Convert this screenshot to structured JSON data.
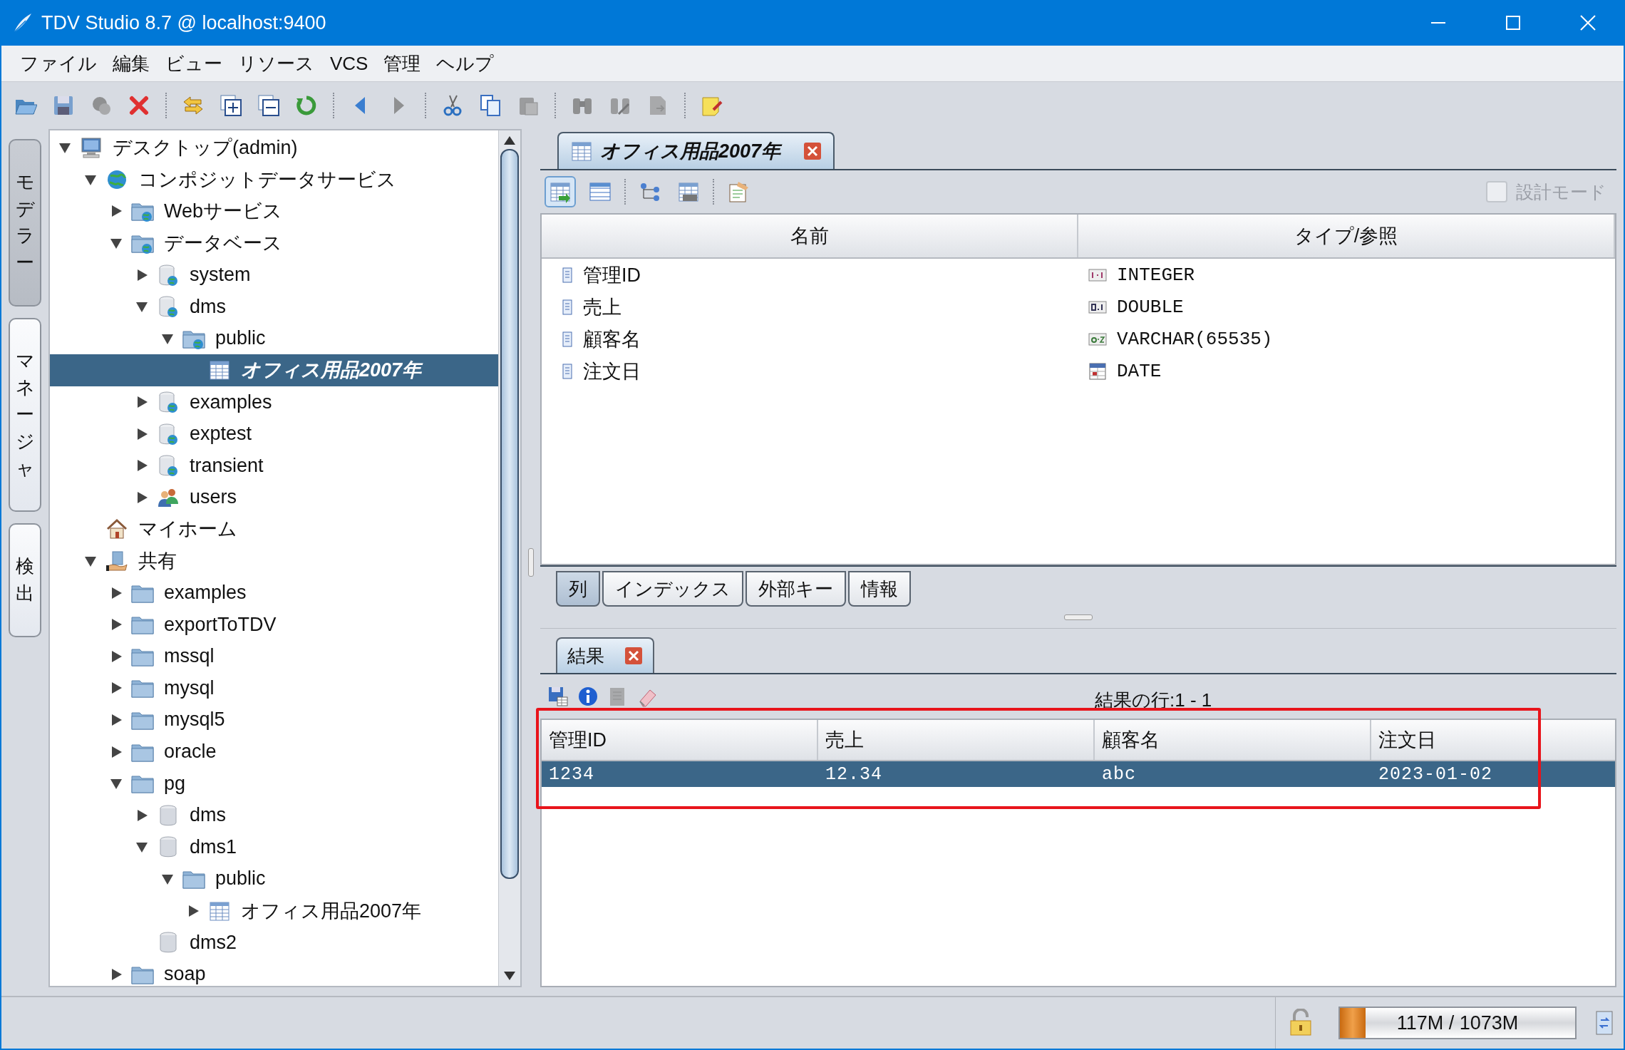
{
  "window": {
    "title": "TDV Studio 8.7 @ localhost:9400"
  },
  "menu": [
    {
      "label": "ファイル"
    },
    {
      "label": "編集"
    },
    {
      "label": "ビュー"
    },
    {
      "label": "リソース"
    },
    {
      "label": "VCS"
    },
    {
      "label": "管理"
    },
    {
      "label": "ヘルプ"
    }
  ],
  "toolbar": [
    [
      {
        "disabled": false
      },
      {
        "disabled": true
      },
      {
        "disabled": true
      },
      {
        "disabled": false
      }
    ],
    [
      {
        "disabled": false
      },
      {
        "disabled": false
      },
      {
        "disabled": false
      },
      {
        "disabled": false
      }
    ],
    [
      {
        "disabled": false
      },
      {
        "disabled": true
      }
    ],
    [
      {
        "disabled": false
      },
      {
        "disabled": false
      },
      {
        "disabled": true
      }
    ],
    [
      {
        "disabled": true
      },
      {
        "disabled": true
      },
      {
        "disabled": true
      }
    ],
    [
      {
        "disabled": false
      }
    ]
  ],
  "side_tabs": [
    {
      "label": "モデラー",
      "selected": true
    },
    {
      "label": "マネージャ",
      "selected": false
    },
    {
      "label": "検出",
      "selected": false
    }
  ],
  "tree": {
    "items": [
      {
        "label": "デスクトップ(admin)",
        "kind": "computer",
        "expanded": true,
        "selected": false,
        "children": [
          {
            "label": "コンポジットデータサービス",
            "kind": "globe",
            "expanded": true,
            "selected": false,
            "children": [
              {
                "label": "Webサービス",
                "kind": "webfolder",
                "expanded": false,
                "selected": false
              },
              {
                "label": "データベース",
                "kind": "webfolder",
                "expanded": true,
                "selected": false,
                "children": [
                  {
                    "label": "system",
                    "kind": "webdb",
                    "expanded": false,
                    "selected": false
                  },
                  {
                    "label": "dms",
                    "kind": "webdb",
                    "expanded": true,
                    "selected": false,
                    "children": [
                      {
                        "label": "public",
                        "kind": "webfolder",
                        "expanded": true,
                        "selected": false,
                        "children": [
                          {
                            "label": "オフィス用品2007年",
                            "kind": "table",
                            "selected": true
                          }
                        ]
                      }
                    ]
                  },
                  {
                    "label": "examples",
                    "kind": "webdb",
                    "expanded": false,
                    "selected": false
                  },
                  {
                    "label": "exptest",
                    "kind": "webdb",
                    "expanded": false,
                    "selected": false
                  },
                  {
                    "label": "transient",
                    "kind": "webdb",
                    "expanded": false,
                    "selected": false
                  },
                  {
                    "label": "users",
                    "kind": "users",
                    "expanded": false,
                    "selected": false
                  }
                ]
              }
            ]
          },
          {
            "label": "マイホーム",
            "kind": "home",
            "selected": false
          },
          {
            "label": "共有",
            "kind": "shared",
            "expanded": true,
            "selected": false,
            "children": [
              {
                "label": "examples",
                "kind": "folder",
                "expanded": false,
                "selected": false
              },
              {
                "label": "exportToTDV",
                "kind": "folder",
                "expanded": false,
                "selected": false
              },
              {
                "label": "mssql",
                "kind": "folder",
                "expanded": false,
                "selected": false
              },
              {
                "label": "mysql",
                "kind": "folder",
                "expanded": false,
                "selected": false
              },
              {
                "label": "mysql5",
                "kind": "folder",
                "expanded": false,
                "selected": false
              },
              {
                "label": "oracle",
                "kind": "folder",
                "expanded": false,
                "selected": false
              },
              {
                "label": "pg",
                "kind": "folder",
                "expanded": true,
                "selected": false,
                "children": [
                  {
                    "label": "dms",
                    "kind": "db",
                    "expanded": false,
                    "selected": false
                  },
                  {
                    "label": "dms1",
                    "kind": "db",
                    "expanded": true,
                    "selected": false,
                    "children": [
                      {
                        "label": "public",
                        "kind": "folder",
                        "expanded": true,
                        "selected": false,
                        "children": [
                          {
                            "label": "オフィス用品2007年",
                            "kind": "table",
                            "expanded": false,
                            "selected": false
                          }
                        ]
                      }
                    ]
                  },
                  {
                    "label": "dms2",
                    "kind": "db",
                    "selected": false
                  }
                ]
              },
              {
                "label": "soap",
                "kind": "folder",
                "expanded": false,
                "selected": false
              }
            ]
          }
        ]
      }
    ]
  },
  "editor_tabs": [
    {
      "label": "オフィス用品2007年",
      "selected": true
    }
  ],
  "design_mode": {
    "label": "設計モード",
    "checked": false,
    "disabled": true
  },
  "columns_table": {
    "columns": [
      "名前",
      "タイプ/参照"
    ],
    "rows": [
      {
        "name": "管理ID",
        "type": "INTEGER",
        "kind": "integer"
      },
      {
        "name": "売上",
        "type": "DOUBLE",
        "kind": "double"
      },
      {
        "name": "顧客名",
        "type": "VARCHAR(65535)",
        "kind": "text"
      },
      {
        "name": "注文日",
        "type": "DATE",
        "kind": "date"
      }
    ]
  },
  "detail_tabs": [
    {
      "label": "列",
      "selected": true
    },
    {
      "label": "インデックス",
      "selected": false
    },
    {
      "label": "外部キー",
      "selected": false
    },
    {
      "label": "情報",
      "selected": false
    }
  ],
  "result_tabs": [
    {
      "label": "結果",
      "selected": true
    }
  ],
  "result_toolbar": [
    {
      "disabled": false
    },
    {
      "disabled": false
    },
    {
      "disabled": true
    },
    {
      "disabled": false
    }
  ],
  "result": {
    "row_count": "結果の行:1 - 1",
    "columns": [
      "管理ID",
      "売上",
      "顧客名",
      "注文日"
    ],
    "rows": [
      {
        "cells": [
          "1234",
          "12.34",
          "abc",
          "2023-01-02"
        ],
        "selected": true
      }
    ]
  },
  "status_bar": {
    "memory": {
      "level": 0.11,
      "reading": "117M / 1073M"
    }
  }
}
